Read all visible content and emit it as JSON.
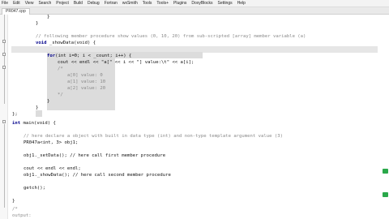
{
  "menu": [
    "File",
    "Edit",
    "View",
    "Search",
    "Project",
    "Build",
    "Debug",
    "Fortran",
    "wxSmith",
    "Tools",
    "Tools+",
    "Plugins",
    "DoxyBlocks",
    "Settings",
    "Help"
  ],
  "tab": "PR047.cpp",
  "code": {
    "l_brace1": "}",
    "l_brace2": "}",
    "comment1": "// following member procedure show values (0, 10, 20) from sub-scripted [array] member variable (a)",
    "func_kw": "void",
    "func_rest": "_showData(void) {",
    "for_kw": "for",
    "for_rest": "(int i=0; i < _count; i++) {",
    "cout_line": "cout << endl << \"a[\" << i << \"] value:\\t\" << a[i];",
    "bcomment_open": "/*",
    "out1": "a[0] value: 0",
    "out2": "a[1] value: 10",
    "out3": "a[2] value: 20",
    "bcomment_close": "*/",
    "inner_close": "}",
    "func_close": "}",
    "class_close": "};",
    "main_kw": "int",
    "main_rest": "main(void) {",
    "comment2": "// here declare a object with built in data type (int) and non-type template argument value (3)",
    "decl": "PR047a<int, 3> obj1;",
    "setdata": "obj1._setData(); // here call first member procedure",
    "cout_endl": "cout << endl << endl;",
    "showdata": "obj1._showData(); // here call second member procedure",
    "getch": "getch();",
    "main_close": "}",
    "output_comment": "/*",
    "output_label": "output:"
  }
}
